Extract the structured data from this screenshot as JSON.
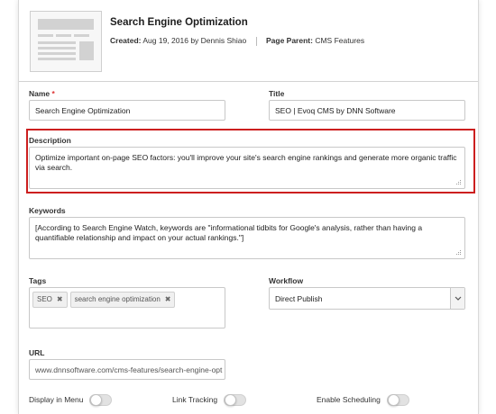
{
  "header": {
    "title": "Search Engine Optimization",
    "created_label": "Created:",
    "created_value": "Aug 19, 2016 by Dennis Shiao",
    "parent_label": "Page Parent:",
    "parent_value": "CMS Features"
  },
  "fields": {
    "name": {
      "label": "Name",
      "required_mark": "*",
      "value": "Search Engine Optimization"
    },
    "title": {
      "label": "Title",
      "value": "SEO | Evoq CMS by DNN Software"
    },
    "description": {
      "label": "Description",
      "value": "Optimize important on-page SEO factors: you'll improve your site's search engine rankings and generate more organic traffic via search."
    },
    "keywords": {
      "label": "Keywords",
      "value": "[According to Search Engine Watch, keywords are \"informational tidbits for Google's analysis, rather than having a quantifiable relationship and impact on your actual rankings.\"]"
    },
    "tags": {
      "label": "Tags",
      "items": [
        "SEO",
        "search engine optimization"
      ],
      "remove_glyph": "✖"
    },
    "workflow": {
      "label": "Workflow",
      "value": "Direct Publish"
    },
    "url": {
      "label": "URL",
      "value": "www.dnnsoftware.com/cms-features/search-engine-opt"
    }
  },
  "toggles": {
    "display_in_menu": {
      "label": "Display in Menu",
      "on": false
    },
    "link_tracking": {
      "label": "Link Tracking",
      "on": false
    },
    "enable_scheduling": {
      "label": "Enable Scheduling",
      "on": false
    }
  },
  "colors": {
    "highlight": "#cc1f1f",
    "required": "#dd3333"
  }
}
